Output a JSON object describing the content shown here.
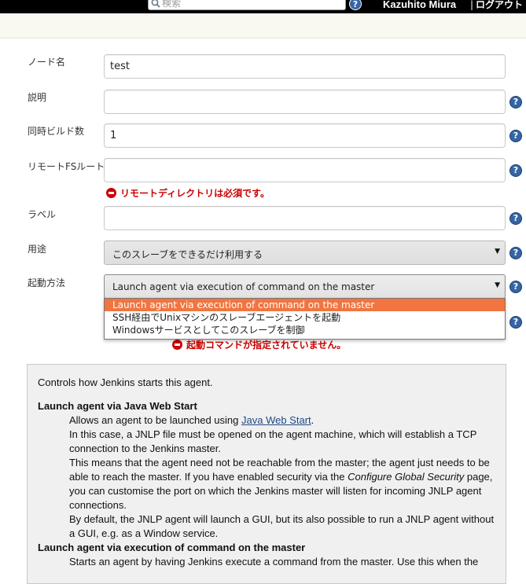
{
  "header": {
    "search_placeholder": "検索",
    "user_name": "Kazuhito Miura",
    "logout_label": "ログアウト",
    "logout_separator": "|"
  },
  "form": {
    "node_name": {
      "label": "ノード名",
      "value": "test"
    },
    "description": {
      "label": "説明",
      "value": ""
    },
    "executors": {
      "label": "同時ビルド数",
      "value": "1"
    },
    "remote_fs": {
      "label": "リモートFSルート",
      "value": "",
      "error": "リモートディレクトリは必須です。"
    },
    "labels": {
      "label": "ラベル",
      "value": ""
    },
    "usage": {
      "label": "用途",
      "selected": "このスレーブをできるだけ利用する"
    },
    "launch_method": {
      "label": "起動方法",
      "selected": "Launch agent via execution of command on the master",
      "options": [
        "Launch agent via execution of command on the master",
        "SSH経由でUnixマシンのスレーブエージェントを起動",
        "Windowsサービスとしてこのスレーブを制御"
      ],
      "error": "起動コマンドが指定されていません。"
    }
  },
  "help_panel": {
    "intro": "Controls how Jenkins starts this agent.",
    "jws": {
      "heading": "Launch agent via Java Web Start",
      "p1_before": "Allows an agent to be launched using ",
      "p1_link": "Java Web Start",
      "p1_after": ".",
      "p2": "In this case, a JNLP file must be opened on the agent machine, which will establish a TCP connection to the Jenkins master.",
      "p3_before": "This means that the agent need not be reachable from the master; the agent just needs to be able to reach the master. If you have enabled security via the ",
      "p3_em": "Configure Global Security",
      "p3_after": " page, you can customise the port on which the Jenkins master will listen for incoming JNLP agent connections.",
      "p4": "By default, the JNLP agent will launch a GUI, but its also possible to run a JNLP agent without a GUI, e.g. as a Window service."
    },
    "command": {
      "heading": "Launch agent via execution of command on the master",
      "p1": "Starts an agent by having Jenkins execute a command from the master. Use this when the"
    }
  },
  "colors": {
    "topbar": "#000000",
    "subbar": "#f9f9f0",
    "error": "#cc0000",
    "dropdown_highlight": "#f07541",
    "help_icon": "#3465a4",
    "help_panel_bg": "#f0f0f0"
  }
}
